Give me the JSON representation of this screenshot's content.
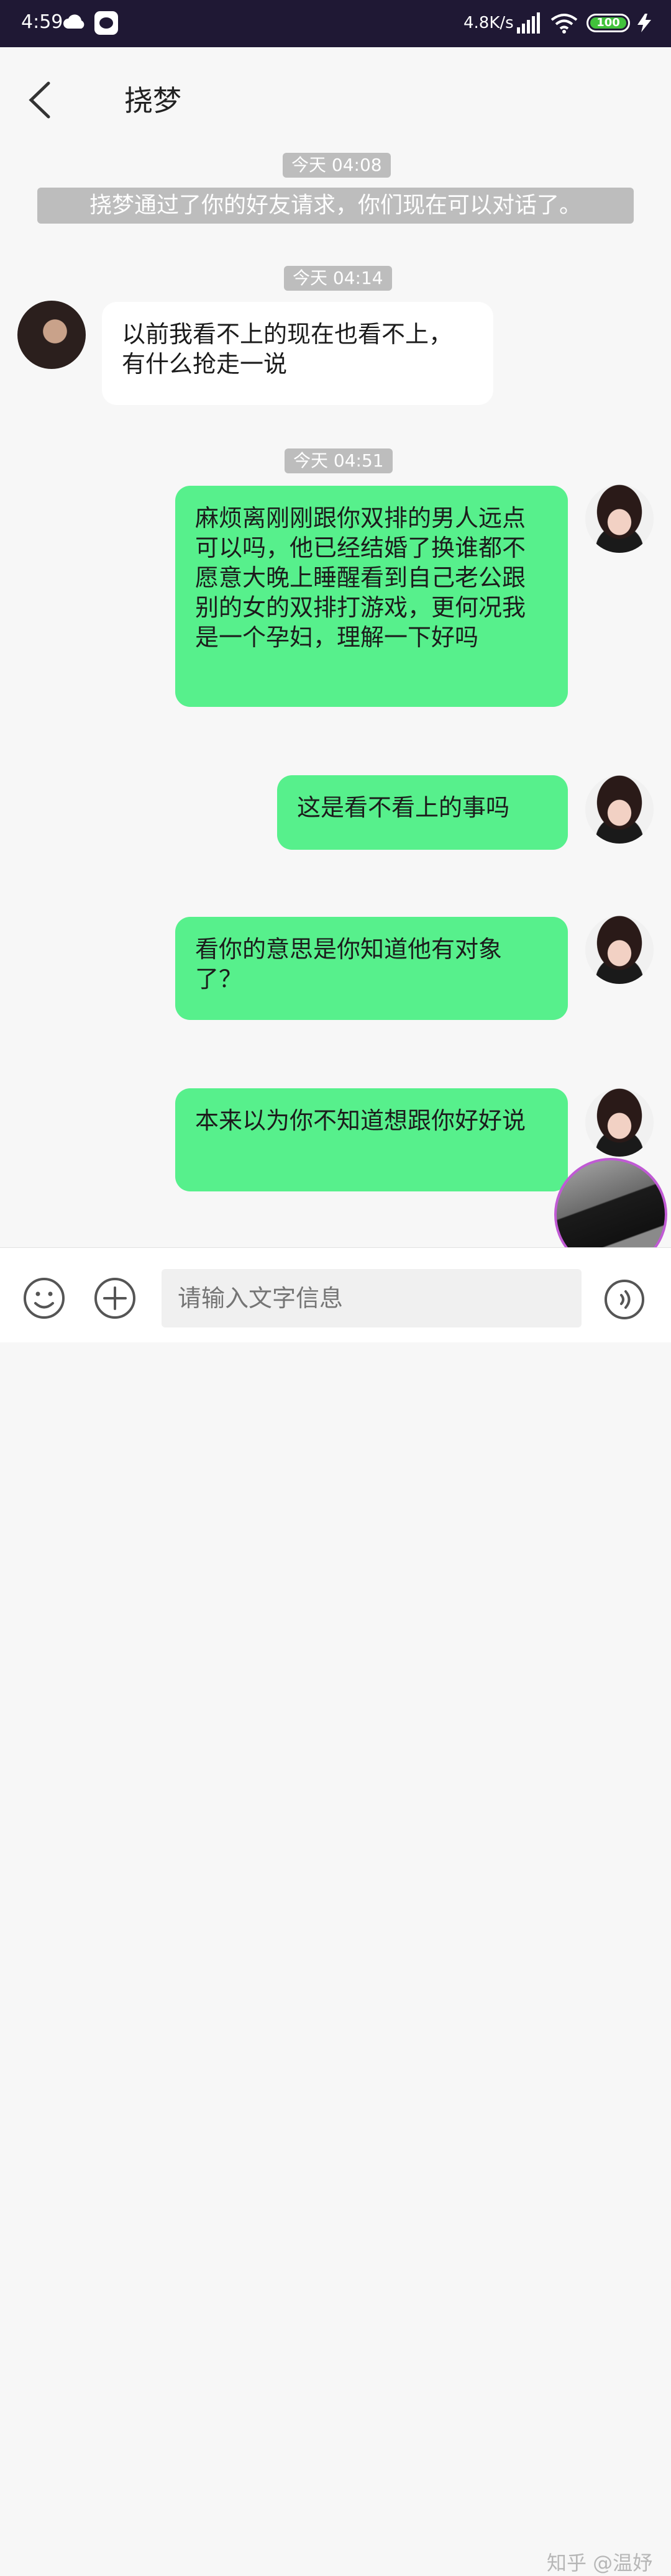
{
  "status_bar": {
    "time": "4:59",
    "network_speed": "4.8K/s",
    "battery": "100",
    "icons": [
      "cloud-icon",
      "app-icon",
      "signal-hd-icon",
      "wifi-icon",
      "battery-icon",
      "charging-icon"
    ]
  },
  "header": {
    "title": "挠梦",
    "back_icon": "chevron-left-icon"
  },
  "chat": {
    "timestamps": [
      "今天 04:08",
      "今天 04:14",
      "今天 04:51"
    ],
    "system_notice": "挠梦通过了你的好友请求，你们现在可以对话了。",
    "messages": [
      {
        "side": "left",
        "text": "以前我看不上的现在也看不上，有什么抢走一说"
      },
      {
        "side": "right",
        "text": "麻烦离刚刚跟你双排的男人远点可以吗，他已经结婚了换谁都不愿意大晚上睡醒看到自己老公跟别的女的双排打游戏，更何况我是一个孕妇，理解一下好吗"
      },
      {
        "side": "right",
        "text": "这是看不看上的事吗"
      },
      {
        "side": "right",
        "text": "看你的意思是你知道他有对象了？"
      },
      {
        "side": "right",
        "text": "本来以为你不知道想跟你好好说"
      }
    ]
  },
  "input_bar": {
    "placeholder": "请输入文字信息",
    "emoji_icon": "emoji-icon",
    "plus_icon": "plus-icon",
    "voice_icon": "voice-icon"
  },
  "watermark": "知乎 @温妤",
  "colors": {
    "status_bar_bg": "#1f1834",
    "sent_bubble": "#57f08c",
    "received_bubble": "#ffffff",
    "timestamp_bg": "#bdbdbd",
    "page_bg": "#f7f7f7"
  }
}
